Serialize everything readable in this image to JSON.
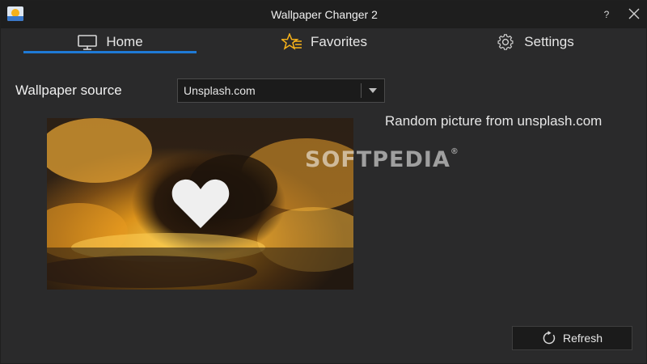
{
  "window": {
    "title": "Wallpaper Changer 2",
    "help_label": "?"
  },
  "tabs": [
    {
      "label": "Home",
      "icon": "monitor-icon",
      "active": true
    },
    {
      "label": "Favorites",
      "icon": "star-list-icon",
      "active": false
    },
    {
      "label": "Settings",
      "icon": "gear-icon",
      "active": false
    }
  ],
  "home": {
    "source_label": "Wallpaper source",
    "source_value": "Unsplash.com",
    "source_description": "Random picture from unsplash.com",
    "refresh_label": "Refresh"
  },
  "watermark": "SOFTPEDIA",
  "colors": {
    "accent": "#1f7ad6",
    "favorite_star": "#f5b11a",
    "background": "#2a2a2b",
    "titlebar": "#1e1e1e"
  }
}
